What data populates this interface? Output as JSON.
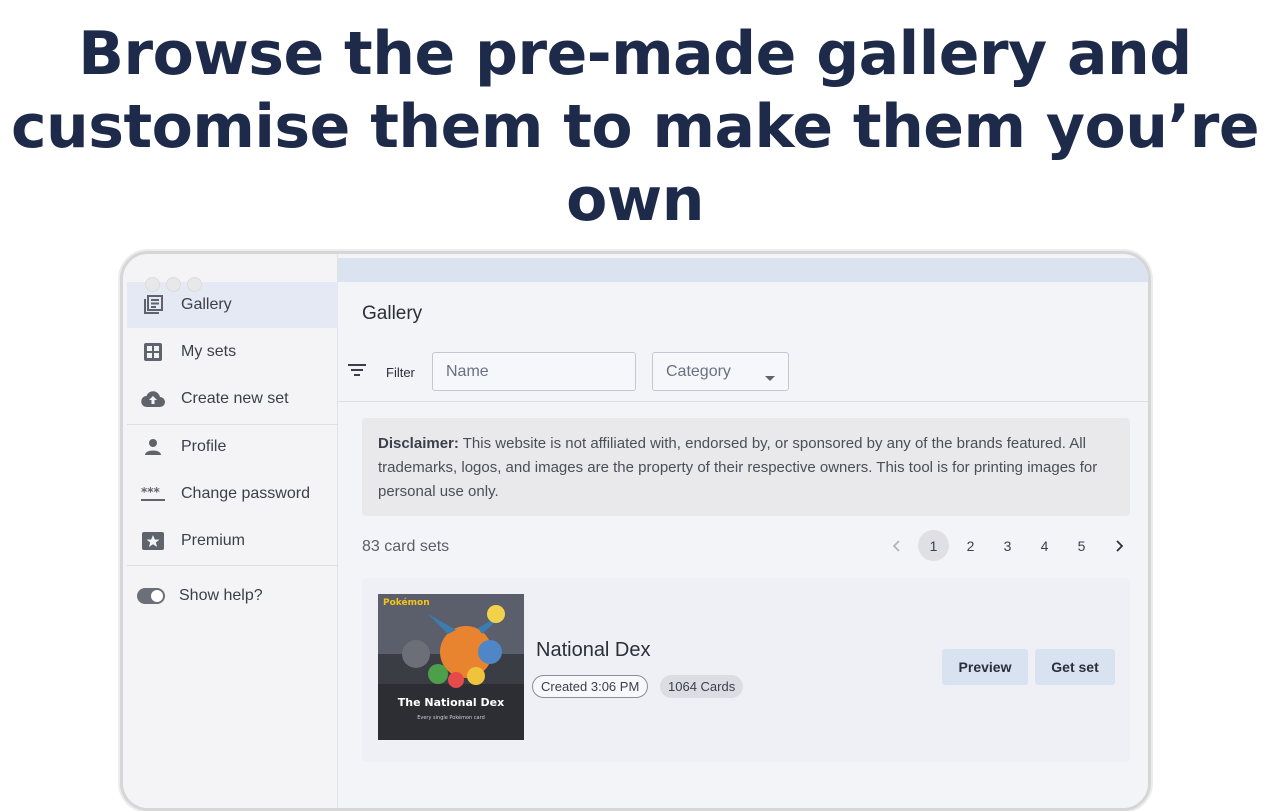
{
  "hero": {
    "line1": "Browse the pre-made gallery and",
    "line2": "customise them to make them you’re",
    "line3": "own"
  },
  "sidebar": {
    "items": [
      {
        "label": "Gallery",
        "icon": "gallery-icon"
      },
      {
        "label": "My sets",
        "icon": "grid-icon"
      },
      {
        "label": "Create new set",
        "icon": "cloud-upload-icon"
      },
      {
        "label": "Profile",
        "icon": "person-icon"
      },
      {
        "label": "Change password",
        "icon": "password-icon"
      },
      {
        "label": "Premium",
        "icon": "star-card-icon"
      }
    ],
    "toggle_label": "Show help?"
  },
  "main": {
    "title": "Gallery",
    "filter_label": "Filter",
    "name_placeholder": "Name",
    "category_placeholder": "Category",
    "disclaimer_bold": "Disclaimer:",
    "disclaimer_text": " This website is not affiliated with, endorsed by, or sponsored by any of the brands featured. All trademarks, logos, and images are the property of their respective owners. This tool is for printing images for personal use only.",
    "count": "83 card sets",
    "pages": [
      "1",
      "2",
      "3",
      "4",
      "5"
    ],
    "current_page": "1"
  },
  "card": {
    "title": "National Dex",
    "created": "Created 3:06 PM",
    "cards": "1064 Cards",
    "thumb_brand": "Pokémon",
    "thumb_caption": "The National Dex",
    "thumb_sub": "Every single Pokémon card",
    "preview_label": "Preview",
    "getset_label": "Get set"
  },
  "colors": {
    "heading": "#1e2a4a",
    "accent_light": "#d9e2f1",
    "active_nav": "#e4e9f3"
  }
}
